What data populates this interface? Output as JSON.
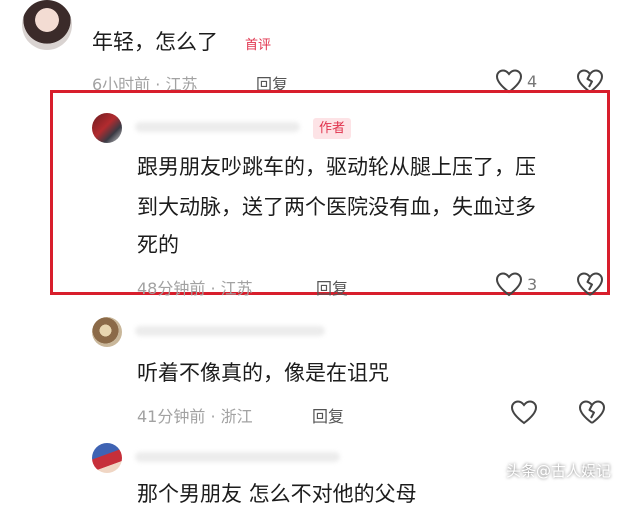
{
  "comments": [
    {
      "text": "年轻，怎么了",
      "tag": "首评",
      "meta": "6小时前 · 江苏",
      "reply_label": "回复",
      "like_count": "4"
    },
    {
      "author_tag": "作者",
      "text_line1": "跟男朋友吵跳车的，驱动轮从腿上压了，压",
      "text_line2": "到大动脉，送了两个医院没有血，失血过多",
      "text_line3": "死的",
      "meta": "48分钟前 · 江苏",
      "reply_label": "回复",
      "like_count": "3"
    },
    {
      "text": "听着不像真的，像是在诅咒",
      "meta": "41分钟前 · 浙江",
      "reply_label": "回复"
    },
    {
      "text": "那个男朋友 怎么不对他的父母"
    }
  ],
  "watermark": "头条@古人娱记",
  "highlight_color": "#d81e2c",
  "icons": [
    "heart-icon",
    "broken-heart-icon"
  ]
}
